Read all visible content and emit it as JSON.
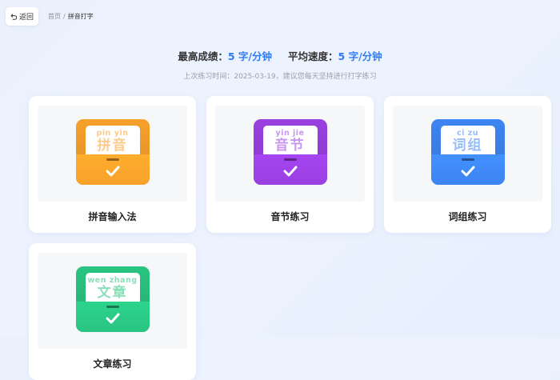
{
  "header": {
    "back_label": "返回",
    "breadcrumb": {
      "home": "首页",
      "separator": "/",
      "current": "拼音打字"
    }
  },
  "stats": {
    "best_label": "最高成绩：",
    "best_value": "5 字/分钟",
    "avg_label": "平均速度：",
    "avg_value": "5 字/分钟",
    "last_practice": "上次练习时间：2025-03-19，建议您每天坚持进行打字练习"
  },
  "cards": [
    {
      "label": "拼音输入法",
      "pinyin": "pin yin",
      "hanzi": "拼音",
      "icon": "pinyin-input-icon",
      "color": "#f7a12b"
    },
    {
      "label": "音节练习",
      "pinyin": "yin jie",
      "hanzi": "音节",
      "icon": "syllable-icon",
      "color": "#9a40e0"
    },
    {
      "label": "词组练习",
      "pinyin": "ci zu",
      "hanzi": "词组",
      "icon": "phrase-icon",
      "color": "#3d85f2"
    },
    {
      "label": "文章练习",
      "pinyin": "wen zhang",
      "hanzi": "文章",
      "icon": "article-icon",
      "color": "#29c482"
    }
  ]
}
